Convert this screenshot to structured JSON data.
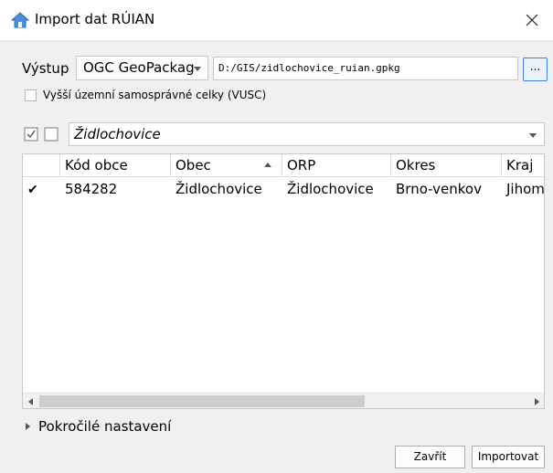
{
  "window": {
    "title": "Import dat RÚIAN",
    "icon": "home-icon"
  },
  "output": {
    "label": "Výstup",
    "format_value": "OGC GeoPackag",
    "path_value": "D:/GIS/zidlochovice_ruian.gpkg",
    "browse_label": "..."
  },
  "vusc": {
    "label": "Vyšší územní samosprávné celky (VUSC)",
    "checked": false
  },
  "filter": {
    "value": "Židlochovice"
  },
  "table": {
    "columns": [
      "",
      "Kód obce",
      "Obec",
      "ORP",
      "Okres",
      "Kraj"
    ],
    "sort_column": "Obec",
    "sort_direction": "ascending",
    "rows": [
      {
        "checked": true,
        "check_glyph": "✔",
        "kod_obce": "584282",
        "obec": "Židlochovice",
        "orp": "Židlochovice",
        "okres": "Brno-venkov",
        "kraj": "Jihom"
      }
    ]
  },
  "advanced": {
    "label": "Pokročilé nastavení"
  },
  "buttons": {
    "close": "Zavřít",
    "import": "Importovat"
  },
  "colors": {
    "accent": "#3c7fd6",
    "background": "#f0f0f0"
  }
}
